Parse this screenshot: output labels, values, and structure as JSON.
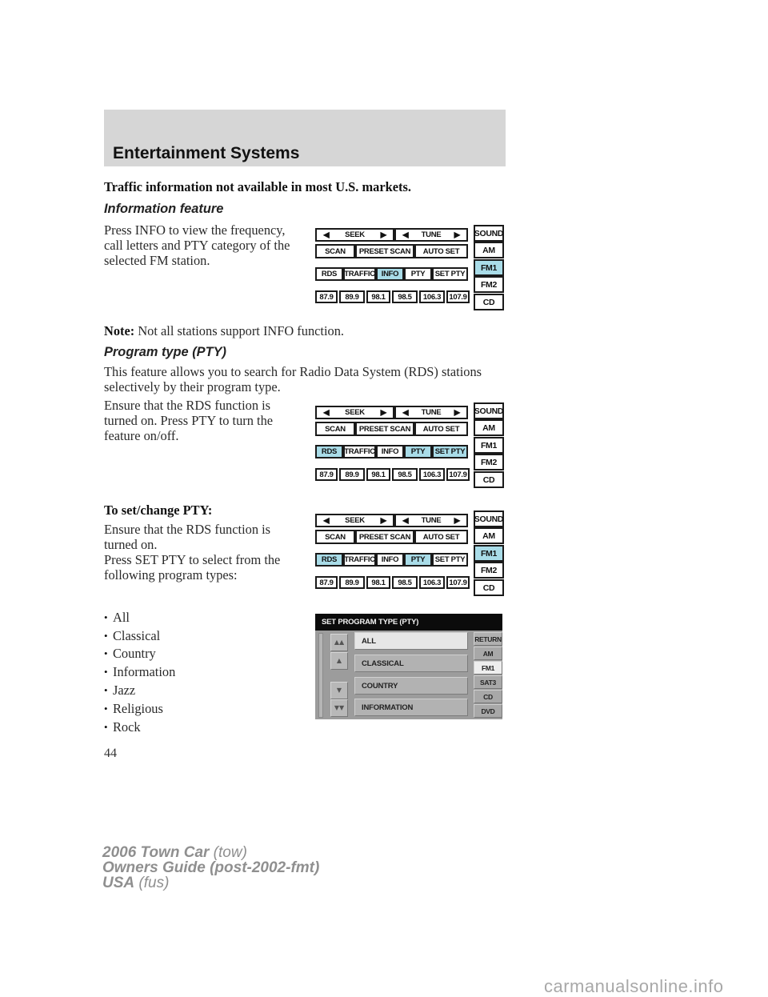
{
  "header": {
    "title": "Entertainment Systems"
  },
  "traffic_note": "Traffic information not available in most U.S. markets.",
  "info_section": {
    "heading": "Information feature",
    "body": "Press INFO to view the frequency,\ncall letters and PTY category of the\nselected FM station.",
    "note_label": "Note:",
    "note_text": " Not all stations support INFO function."
  },
  "pty_section": {
    "heading": "Program type (PTY)",
    "intro": "This feature allows you to search for Radio Data System (RDS) stations\nselectively by their program type.",
    "ensure": "Ensure that the RDS function is\nturned on. Press PTY to turn the\nfeature on/off.",
    "set_heading": "To set/change PTY:",
    "set_body": "Ensure that the RDS function is\nturned on.\nPress SET PTY to select from the\nfollowing program types:",
    "bullet_glyph": "•",
    "program_types": [
      "All",
      "Classical",
      "Country",
      "Information",
      "Jazz",
      "Religious",
      "Rock"
    ]
  },
  "radio_panel": {
    "seek": "SEEK",
    "tune": "TUNE",
    "arrow_left": "◀",
    "arrow_right": "▶",
    "scan": "SCAN",
    "preset_scan": "PRESET SCAN",
    "auto_set": "AUTO SET",
    "rds": "RDS",
    "traffic": "TRAFFIC",
    "info": "INFO",
    "pty": "PTY",
    "set_pty": "SET PTY",
    "presets": [
      "87.9",
      "89.9",
      "98.1",
      "98.5",
      "106.3",
      "107.9"
    ],
    "sources": [
      "SOUND",
      "AM",
      "FM1",
      "FM2",
      "CD"
    ],
    "highlight_color": "#a9dce8"
  },
  "panel_states": [
    {
      "name": "info-panel",
      "highlighted": [
        "info",
        "FM1"
      ]
    },
    {
      "name": "pty-toggle-panel",
      "highlighted": [
        "rds",
        "pty",
        "set_pty"
      ]
    },
    {
      "name": "set-pty-panel",
      "highlighted": [
        "rds",
        "pty",
        "FM1"
      ]
    }
  ],
  "pty_screen": {
    "title": "SET PROGRAM TYPE (PTY)",
    "items": [
      "ALL",
      "CLASSICAL",
      "COUNTRY",
      "INFORMATION"
    ],
    "selected_item": "ALL",
    "nav_icons": [
      "page-up-icon",
      "line-up-icon",
      "line-down-icon",
      "page-down-icon"
    ],
    "nav_glyphs": [
      "▲▲",
      "▲",
      "▼",
      "▼▼"
    ],
    "side_buttons": [
      "RETURN",
      "AM",
      "FM1",
      "SAT3",
      "CD",
      "DVD"
    ],
    "selected_side": "FM1"
  },
  "page_number": "44",
  "footer": {
    "line1_bold": "2006 Town Car",
    "line1_light": " (tow)",
    "line2_bold": "Owners Guide (post-2002-fmt)",
    "line3_bold": "USA",
    "line3_light": " (fus)"
  },
  "watermark": "carmanualsonline.info"
}
